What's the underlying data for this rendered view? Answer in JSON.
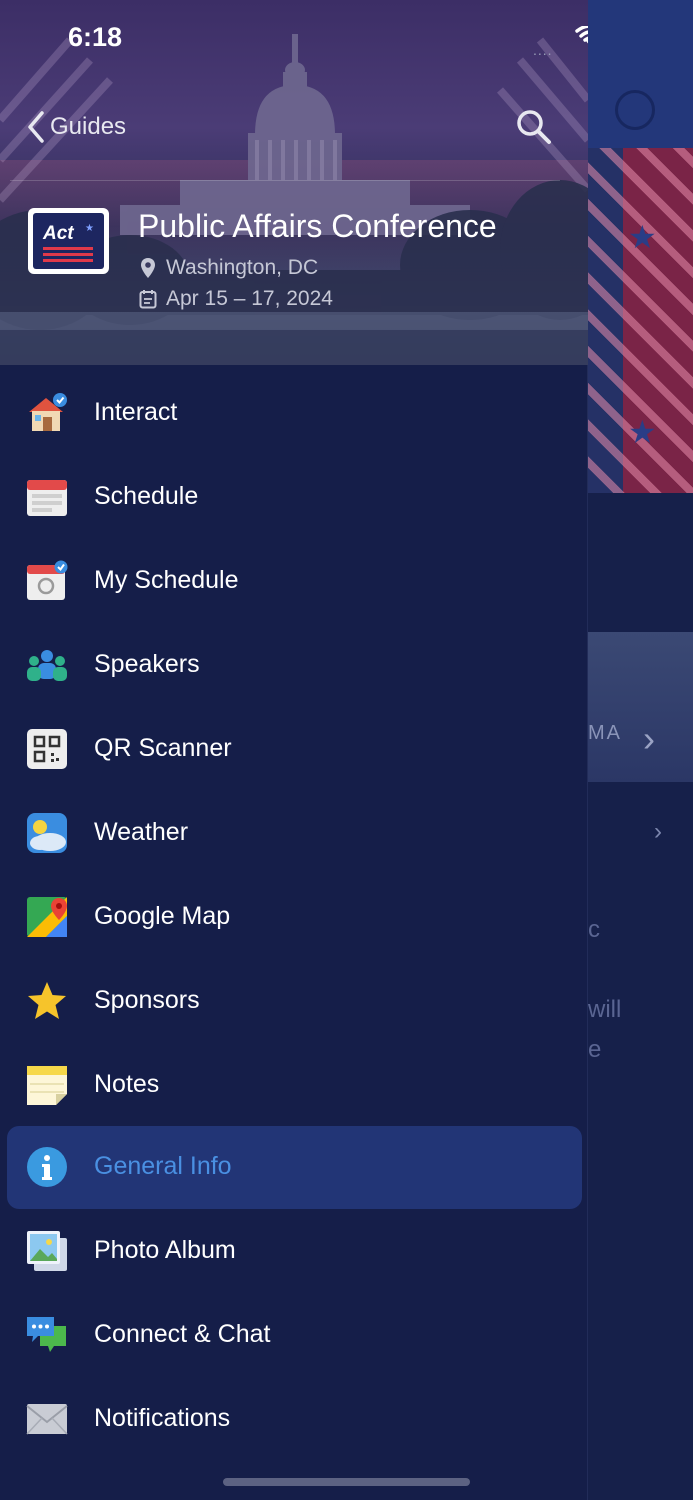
{
  "status_bar": {
    "time": "6:18",
    "signal": "....",
    "wifi_icon": "wifi-icon",
    "battery_icon": "battery-icon"
  },
  "nav": {
    "back_label": "Guides",
    "back_icon": "chevron-left-icon",
    "search_icon": "search-icon"
  },
  "event": {
    "title": "Public Affairs Conference",
    "location": "Washington, DC",
    "dates": "Apr 15 – 17, 2024",
    "logo_word": "Act",
    "location_icon": "map-pin-icon",
    "calendar_icon": "calendar-icon"
  },
  "menu": {
    "items": [
      {
        "label": "Interact",
        "icon": "interact-icon"
      },
      {
        "label": "Schedule",
        "icon": "schedule-icon"
      },
      {
        "label": "My Schedule",
        "icon": "my-schedule-icon"
      },
      {
        "label": "Speakers",
        "icon": "speakers-icon"
      },
      {
        "label": "QR Scanner",
        "icon": "qr-scanner-icon"
      },
      {
        "label": "Weather",
        "icon": "weather-icon"
      },
      {
        "label": "Google Map",
        "icon": "google-map-icon"
      },
      {
        "label": "Sponsors",
        "icon": "sponsors-icon"
      },
      {
        "label": "Notes",
        "icon": "notes-icon"
      },
      {
        "label": "General Info",
        "icon": "info-icon",
        "active": true
      },
      {
        "label": "Photo Album",
        "icon": "photo-album-icon"
      },
      {
        "label": "Connect & Chat",
        "icon": "chat-icon"
      },
      {
        "label": "Notifications",
        "icon": "mail-icon"
      }
    ],
    "active_color": "#4a90e2",
    "active_bg": "#223576"
  },
  "background_app": {
    "map_text": "MA",
    "partial_text_1": "c",
    "partial_text_2": "will",
    "partial_text_3": "e"
  },
  "colors": {
    "drawer_bg": "#151e49",
    "header_accent": "#23377a"
  }
}
